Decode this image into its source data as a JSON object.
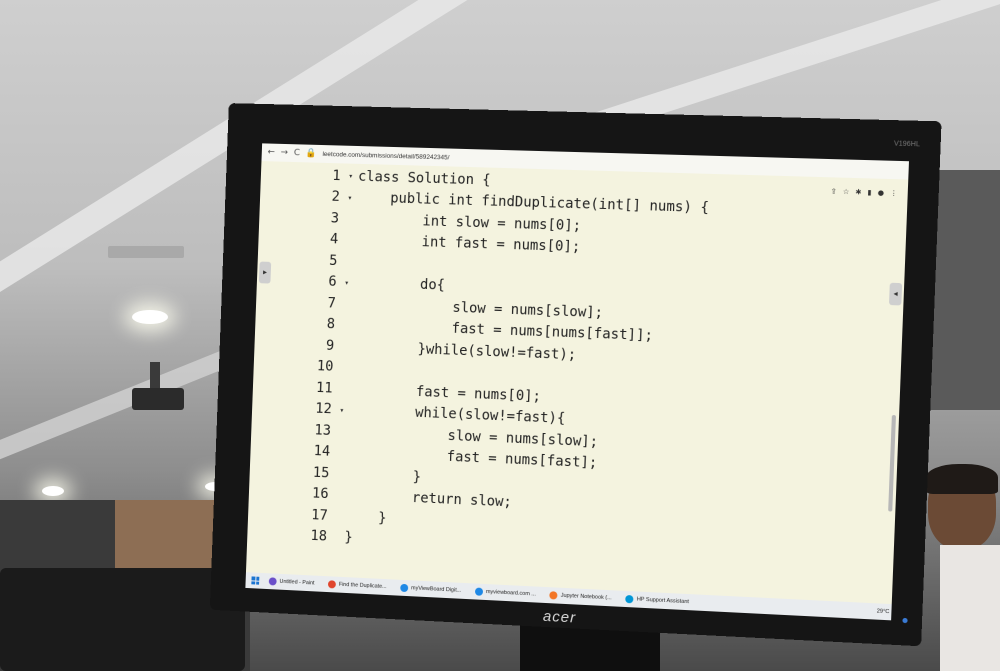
{
  "browser": {
    "url": "leetcode.com/submissions/detail/589242345/",
    "nav_back": "←",
    "nav_forward": "→",
    "nav_reload": "C"
  },
  "monitor": {
    "brand": "acer",
    "model": "V196HL"
  },
  "editor": {
    "lines": [
      {
        "num": "1",
        "fold": "▾",
        "code": "class Solution {"
      },
      {
        "num": "2",
        "fold": "▾",
        "code": "    public int findDuplicate(int[] nums) {"
      },
      {
        "num": "3",
        "fold": "",
        "code": "        int slow = nums[0];"
      },
      {
        "num": "4",
        "fold": "",
        "code": "        int fast = nums[0];"
      },
      {
        "num": "5",
        "fold": "",
        "code": ""
      },
      {
        "num": "6",
        "fold": "▾",
        "code": "        do{"
      },
      {
        "num": "7",
        "fold": "",
        "code": "            slow = nums[slow];"
      },
      {
        "num": "8",
        "fold": "",
        "code": "            fast = nums[nums[fast]];"
      },
      {
        "num": "9",
        "fold": "",
        "code": "        }while(slow!=fast);"
      },
      {
        "num": "10",
        "fold": "",
        "code": ""
      },
      {
        "num": "11",
        "fold": "",
        "code": "        fast = nums[0];"
      },
      {
        "num": "12",
        "fold": "▾",
        "code": "        while(slow!=fast){"
      },
      {
        "num": "13",
        "fold": "",
        "code": "            slow = nums[slow];"
      },
      {
        "num": "14",
        "fold": "",
        "code": "            fast = nums[fast];"
      },
      {
        "num": "15",
        "fold": "",
        "code": "        }"
      },
      {
        "num": "16",
        "fold": "",
        "code": "        return slow;"
      },
      {
        "num": "17",
        "fold": "",
        "code": "    }"
      },
      {
        "num": "18",
        "fold": "",
        "code": "}"
      }
    ]
  },
  "taskbar": {
    "items": [
      {
        "label": "Untitled - Paint",
        "color": "#6a4fc9"
      },
      {
        "label": "Find the Duplicate...",
        "color": "#e0452c"
      },
      {
        "label": "myViewBoard Digit...",
        "color": "#1e88e5"
      },
      {
        "label": "myviewboard.com ...",
        "color": "#1e88e5"
      },
      {
        "label": "Jupyter Notebook (...",
        "color": "#f37626"
      },
      {
        "label": "HP Support Assistant",
        "color": "#0096d6"
      }
    ],
    "weather": "29°C"
  }
}
